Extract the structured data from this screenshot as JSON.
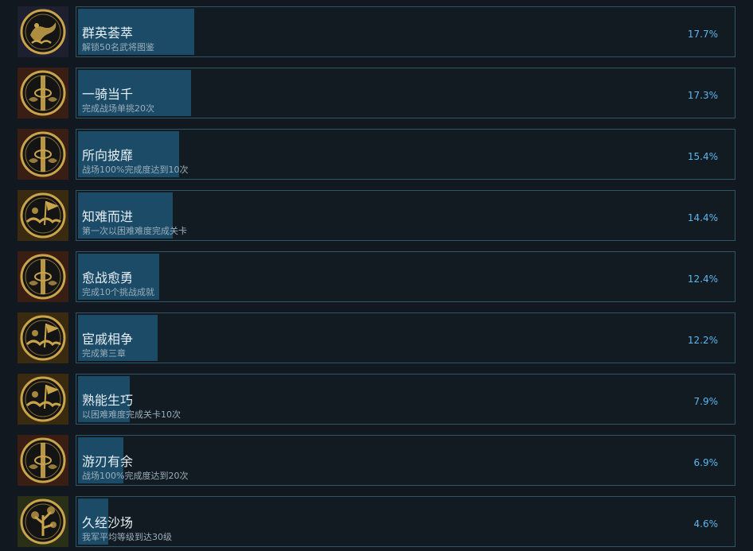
{
  "theme": {
    "gold": "#c9a44a",
    "fill": "#1b4b66",
    "border": "#2f5566",
    "percent": "#5bb8f0"
  },
  "achievements": [
    {
      "name": "群英荟萃",
      "desc": "解锁50名武将图鉴",
      "percent_text": "17.7%",
      "percent": 17.7,
      "icon": "dragon-cloud-medal-icon",
      "icon_bg": "#1e2030"
    },
    {
      "name": "一骑当千",
      "desc": "完成战场单挑20次",
      "percent_text": "17.3%",
      "percent": 17.3,
      "icon": "sword-medal-icon",
      "icon_bg": "#3a1e14"
    },
    {
      "name": "所向披靡",
      "desc": "战场100%完成度达到10次",
      "percent_text": "15.4%",
      "percent": 15.4,
      "icon": "sword-medal-icon",
      "icon_bg": "#3a1e14"
    },
    {
      "name": "知难而进",
      "desc": "第一次以困难难度完成关卡",
      "percent_text": "14.4%",
      "percent": 14.4,
      "icon": "flag-cloud-medal-icon",
      "icon_bg": "#3a2a10"
    },
    {
      "name": "愈战愈勇",
      "desc": "完成10个挑战成就",
      "percent_text": "12.4%",
      "percent": 12.4,
      "icon": "sword-medal-icon",
      "icon_bg": "#3a1e14"
    },
    {
      "name": "宦戚相争",
      "desc": "完成第三章",
      "percent_text": "12.2%",
      "percent": 12.2,
      "icon": "flag-cloud-medal-icon",
      "icon_bg": "#3a2a10"
    },
    {
      "name": "熟能生巧",
      "desc": "以困难难度完成关卡10次",
      "percent_text": "7.9%",
      "percent": 7.9,
      "icon": "flag-cloud-medal-icon",
      "icon_bg": "#3a2a10"
    },
    {
      "name": "游刃有余",
      "desc": "战场100%完成度达到20次",
      "percent_text": "6.9%",
      "percent": 6.9,
      "icon": "sword-medal-icon",
      "icon_bg": "#3a1e14"
    },
    {
      "name": "久经沙场",
      "desc": "我军平均等级到达30级",
      "percent_text": "4.6%",
      "percent": 4.6,
      "icon": "tree-medal-icon",
      "icon_bg": "#2a3018"
    }
  ]
}
